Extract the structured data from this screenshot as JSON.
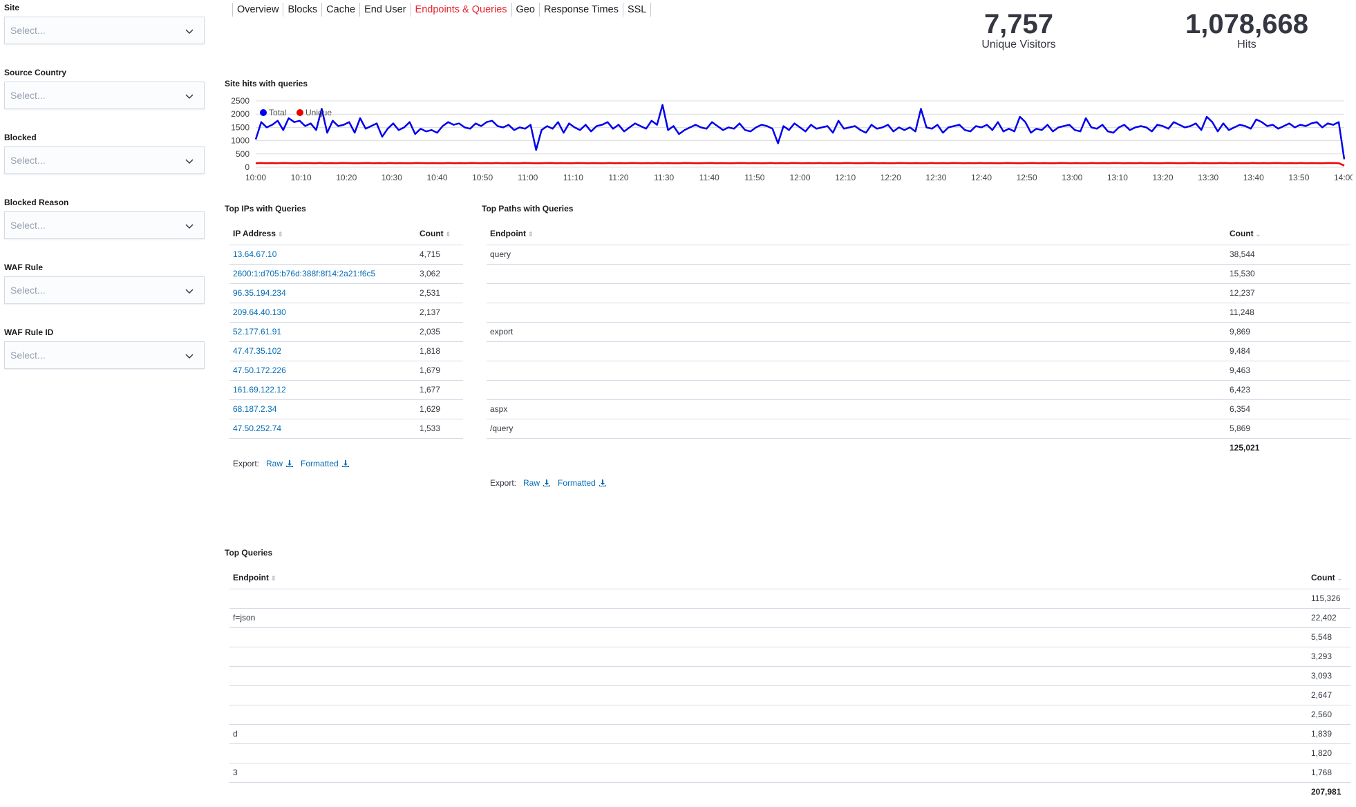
{
  "filters": [
    {
      "label": "Site",
      "placeholder": "Select..."
    },
    {
      "label": "Source Country",
      "placeholder": "Select..."
    },
    {
      "label": "Blocked",
      "placeholder": "Select..."
    },
    {
      "label": "Blocked Reason",
      "placeholder": "Select..."
    },
    {
      "label": "WAF Rule",
      "placeholder": "Select..."
    },
    {
      "label": "WAF Rule ID",
      "placeholder": "Select..."
    }
  ],
  "tabs": [
    "Overview",
    "Blocks",
    "Cache",
    "End User",
    "Endpoints & Queries",
    "Geo",
    "Response Times",
    "SSL"
  ],
  "active_tab": "Endpoints & Queries",
  "metrics": {
    "unique_visitors": {
      "value": "7,757",
      "label": "Unique Visitors"
    },
    "hits": {
      "value": "1,078,668",
      "label": "Hits"
    }
  },
  "site_hits": {
    "title": "Site hits with queries"
  },
  "chart_data": {
    "type": "line",
    "title": "Site hits with queries",
    "x": [
      "10:00",
      "10:10",
      "10:20",
      "10:30",
      "10:40",
      "10:50",
      "11:00",
      "11:10",
      "11:20",
      "11:30",
      "11:40",
      "11:50",
      "12:00",
      "12:10",
      "12:20",
      "12:30",
      "12:40",
      "12:50",
      "13:00",
      "13:10",
      "13:20",
      "13:30",
      "13:40",
      "13:50",
      "14:00"
    ],
    "ylim": [
      0,
      2500
    ],
    "yticks": [
      0,
      500,
      1000,
      1500,
      2000,
      2500
    ],
    "legend": "top-left",
    "series": [
      {
        "name": "Total",
        "color": "#0000ee",
        "values": [
          1050,
          1700,
          1500,
          1600,
          1750,
          1400,
          1850,
          1700,
          1750,
          1550,
          1650,
          1400,
          2200,
          1300,
          1750,
          1550,
          1600,
          1700,
          1300,
          1850,
          1450,
          1550,
          1650,
          1150,
          1450,
          1650,
          1400,
          1500,
          1700,
          1250,
          1450,
          1350,
          1400,
          1300,
          1550,
          1700,
          1600,
          1650,
          1500,
          1450,
          1650,
          1550,
          1700,
          1750,
          1550,
          1500,
          1600,
          1400,
          1500,
          1450,
          1600,
          650,
          1400,
          1550,
          1450,
          1700,
          1300,
          1650,
          1500,
          1400,
          1600,
          1350,
          1550,
          1600,
          1700,
          1450,
          1600,
          1350,
          1500,
          1650,
          1550,
          1450,
          1750,
          1600,
          2350,
          1400,
          1550,
          1250,
          1400,
          1500,
          1600,
          1500,
          1450,
          1700,
          1550,
          1400,
          1500,
          1450,
          1650,
          1400,
          1350,
          1500,
          1600,
          1550,
          1450,
          900,
          1550,
          1400,
          1650,
          1500,
          1350,
          1600,
          1450,
          1500,
          1550,
          1300,
          1750,
          1450,
          1500,
          1550,
          1400,
          1300,
          1600,
          1450,
          1500,
          1600,
          1350,
          1500,
          1400,
          1500,
          1350,
          2200,
          1500,
          1450,
          1600,
          1300,
          1500,
          1550,
          1600,
          1400,
          1350,
          1550,
          1500,
          1600,
          1400,
          1700,
          1350,
          1450,
          1350,
          1900,
          1700,
          1300,
          1450,
          1400,
          1600,
          1350,
          1500,
          1550,
          1600,
          1400,
          1350,
          1850,
          1500,
          1450,
          1600,
          1350,
          1300,
          1500,
          1600,
          1400,
          1500,
          1550,
          1500,
          1350,
          1600,
          1550,
          1450,
          1700,
          1600,
          1500,
          1550,
          1650,
          1400,
          1900,
          1700,
          1350,
          1650,
          1400,
          1500,
          1600,
          1550,
          1450,
          1800,
          1700,
          1550,
          1600,
          1450,
          1550,
          1650,
          1500,
          1600,
          1550,
          1650,
          1700,
          1500,
          1650,
          1600,
          1700,
          300
        ]
      },
      {
        "name": "Unique",
        "color": "#ee0000",
        "values": [
          150,
          160,
          150,
          155,
          150,
          160,
          155,
          150,
          150,
          160,
          155,
          150,
          160,
          150,
          155,
          150,
          160,
          155,
          150,
          150,
          155,
          160,
          150,
          155,
          150,
          160,
          150,
          155,
          150,
          150,
          160,
          155,
          150,
          155,
          150,
          150,
          160,
          150,
          155,
          150,
          160,
          155,
          150,
          155,
          150,
          160,
          150,
          155,
          150,
          150,
          160,
          155,
          150,
          150,
          155,
          160,
          150,
          155,
          150,
          150,
          160,
          155,
          150,
          155,
          150,
          150,
          160,
          150,
          155,
          150,
          160,
          155,
          150,
          155,
          150,
          160,
          150,
          155,
          150,
          150,
          160,
          155,
          150,
          150,
          155,
          160,
          150,
          155,
          150,
          150,
          160,
          155,
          150,
          155,
          150,
          150,
          160,
          150,
          155,
          150,
          160,
          155,
          150,
          155,
          150,
          160,
          150,
          155,
          150,
          150,
          160,
          155,
          150,
          150,
          155,
          160,
          150,
          155,
          150,
          150,
          160,
          155,
          150,
          155,
          150,
          150,
          160,
          150,
          155,
          150,
          160,
          155,
          150,
          155,
          150,
          160,
          150,
          155,
          150,
          150,
          160,
          155,
          150,
          150,
          155,
          160,
          150,
          155,
          150,
          150,
          160,
          155,
          150,
          155,
          150,
          150,
          160,
          150,
          155,
          150,
          160,
          155,
          150,
          155,
          150,
          160,
          150,
          155,
          150,
          150,
          160,
          155,
          150,
          150,
          155,
          160,
          150,
          155,
          150,
          150,
          160,
          155,
          150,
          155,
          150,
          150,
          160,
          150,
          155,
          150,
          160,
          155,
          150,
          155,
          150,
          160,
          150,
          155,
          150,
          150,
          160,
          155,
          150,
          60
        ]
      }
    ]
  },
  "top_ips": {
    "title": "Top IPs with Queries",
    "headers": {
      "ip": "IP Address",
      "count": "Count"
    },
    "rows": [
      {
        "ip": "13.64.67.10",
        "count": "4,715"
      },
      {
        "ip": "2600:1:d705:b76d:388f:8f14:2a21:f6c5",
        "count": "3,062"
      },
      {
        "ip": "96.35.194.234",
        "count": "2,531"
      },
      {
        "ip": "209.64.40.130",
        "count": "2,137"
      },
      {
        "ip": "52.177.61.91",
        "count": "2,035"
      },
      {
        "ip": "47.47.35.102",
        "count": "1,818"
      },
      {
        "ip": "47.50.172.226",
        "count": "1,679"
      },
      {
        "ip": "161.69.122.12",
        "count": "1,677"
      },
      {
        "ip": "68.187.2.34",
        "count": "1,629"
      },
      {
        "ip": "47.50.252.74",
        "count": "1,533"
      }
    ],
    "export_label": "Export:",
    "raw_label": "Raw",
    "formatted_label": "Formatted"
  },
  "top_paths": {
    "title": "Top Paths with Queries",
    "headers": {
      "endpoint": "Endpoint",
      "count": "Count"
    },
    "rows": [
      {
        "endpoint": "query",
        "count": "38,544"
      },
      {
        "endpoint": "",
        "count": "15,530"
      },
      {
        "endpoint": "",
        "count": "12,237"
      },
      {
        "endpoint": "",
        "count": "11,248"
      },
      {
        "endpoint": "export",
        "count": "9,869"
      },
      {
        "endpoint": "",
        "count": "9,484"
      },
      {
        "endpoint": "",
        "count": "9,463"
      },
      {
        "endpoint": "",
        "count": "6,423"
      },
      {
        "endpoint": "aspx",
        "count": "6,354"
      },
      {
        "endpoint": "/query",
        "count": "5,869"
      }
    ],
    "total": "125,021",
    "export_label": "Export:",
    "raw_label": "Raw",
    "formatted_label": "Formatted"
  },
  "top_queries": {
    "title": "Top Queries",
    "headers": {
      "endpoint": "Endpoint",
      "count": "Count"
    },
    "rows": [
      {
        "endpoint": "",
        "count": "115,326"
      },
      {
        "endpoint": "f=json",
        "count": "22,402"
      },
      {
        "endpoint": "",
        "count": "5,548"
      },
      {
        "endpoint": "",
        "count": "3,293"
      },
      {
        "endpoint": "",
        "count": "3,093"
      },
      {
        "endpoint": "",
        "count": "2,647"
      },
      {
        "endpoint": "",
        "count": "2,560"
      },
      {
        "endpoint": "d",
        "count": "1,839"
      },
      {
        "endpoint": "",
        "count": "1,820"
      },
      {
        "endpoint": "3",
        "count": "1,768"
      }
    ],
    "total": "207,981"
  }
}
